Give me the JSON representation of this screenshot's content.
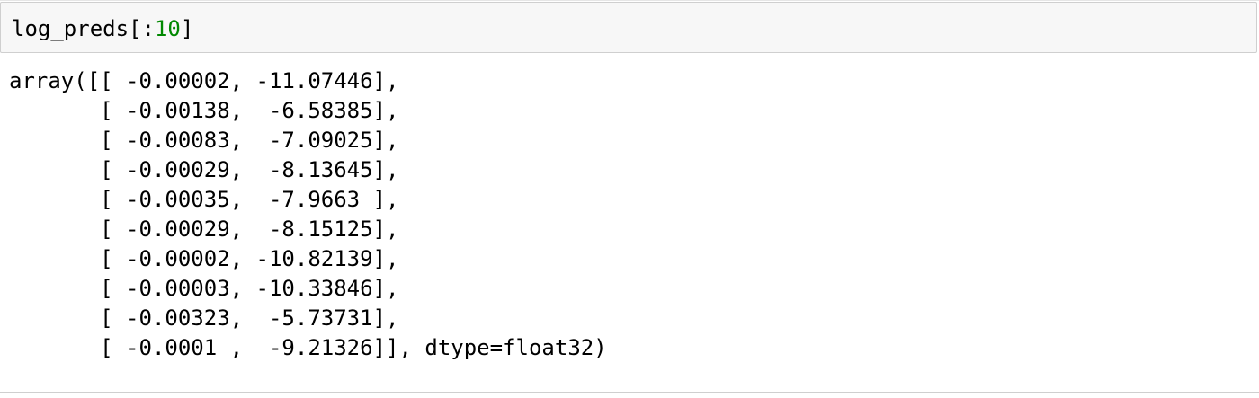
{
  "input_cell": {
    "code_prefix": "log_preds[:",
    "code_number": "10",
    "code_suffix": "]"
  },
  "output_cell": {
    "lines": [
      "array([[ -0.00002, -11.07446],",
      "       [ -0.00138,  -6.58385],",
      "       [ -0.00083,  -7.09025],",
      "       [ -0.00029,  -8.13645],",
      "       [ -0.00035,  -7.9663 ],",
      "       [ -0.00029,  -8.15125],",
      "       [ -0.00002, -10.82139],",
      "       [ -0.00003, -10.33846],",
      "       [ -0.00323,  -5.73731],",
      "       [ -0.0001 ,  -9.21326]], dtype=float32)"
    ]
  }
}
